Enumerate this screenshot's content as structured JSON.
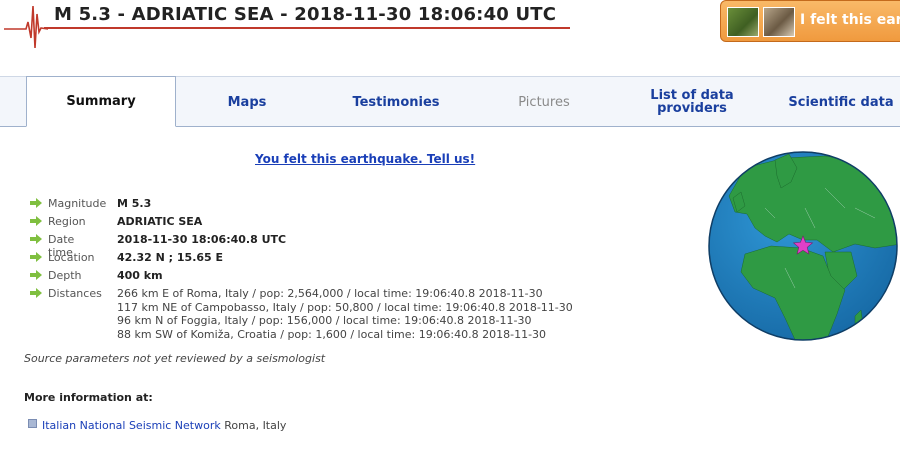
{
  "header": {
    "title": "M 5.3 - ADRIATIC SEA - 2018-11-30 18:06:40 UTC",
    "felt_button": "I felt this earth"
  },
  "tabs": [
    {
      "label": "Summary",
      "state": "active"
    },
    {
      "label": "Maps",
      "state": "normal"
    },
    {
      "label": "Testimonies",
      "state": "normal"
    },
    {
      "label": "Pictures",
      "state": "disabled"
    },
    {
      "label": "List of data providers",
      "state": "normal"
    },
    {
      "label": "Scientific data",
      "state": "normal"
    }
  ],
  "felt_link": "You felt this earthquake. Tell us!",
  "info": {
    "magnitude_label": "Magnitude",
    "magnitude": "M 5.3",
    "region_label": "Region",
    "region": "ADRIATIC SEA",
    "datetime_label": "Date time",
    "datetime": "2018-11-30 18:06:40.8 UTC",
    "location_label": "Location",
    "location": "42.32 N ; 15.65 E",
    "depth_label": "Depth",
    "depth": "400 km",
    "distances_label": "Distances",
    "distances": [
      "266 km E of Roma, Italy / pop: 2,564,000 / local time: 19:06:40.8 2018-11-30",
      "117 km NE of Campobasso, Italy / pop: 50,800 / local time: 19:06:40.8 2018-11-30",
      "96 km N of Foggia, Italy / pop: 156,000 / local time: 19:06:40.8 2018-11-30",
      "88 km SW of Komiža, Croatia / pop: 1,600 / local time: 19:06:40.8 2018-11-30"
    ]
  },
  "source_note": "Source parameters not yet reviewed by a seismologist",
  "more_info": {
    "heading": "More information at:",
    "network_link": "Italian National Seismic Network",
    "network_place": "Roma, Italy"
  },
  "colors": {
    "title_rule": "#c0392b",
    "tab_link": "#1a3f9e",
    "arrow": "#7fbf3f",
    "epicenter_star": "#e040c8",
    "ocean": "#1f86c8",
    "land": "#2f9a44"
  },
  "icons": [
    "seismogram-icon",
    "arrow-right-icon",
    "star-icon",
    "globe-map"
  ]
}
